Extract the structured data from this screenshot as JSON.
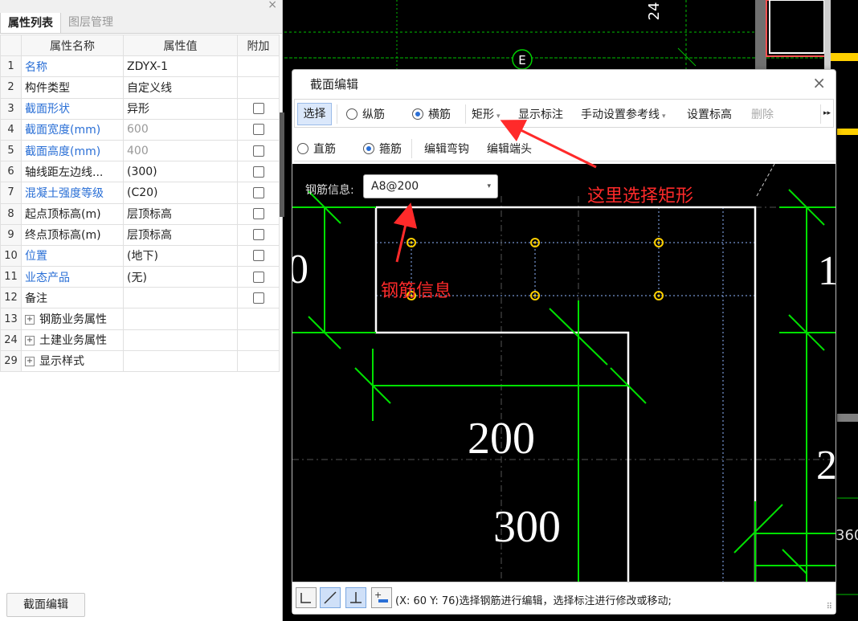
{
  "left_panel": {
    "tabs": [
      {
        "label": "属性列表",
        "active": true
      },
      {
        "label": "图层管理",
        "active": false
      }
    ],
    "columns": {
      "num": "",
      "name": "属性名称",
      "value": "属性值",
      "attach": "附加"
    },
    "rows": [
      {
        "num": "1",
        "name": "名称",
        "value": "ZDYX-1",
        "name_blue": true,
        "value_gray": false,
        "checkbox": false
      },
      {
        "num": "2",
        "name": "构件类型",
        "value": "自定义线",
        "name_blue": false,
        "value_gray": false,
        "checkbox": false
      },
      {
        "num": "3",
        "name": "截面形状",
        "value": "异形",
        "name_blue": true,
        "value_gray": false,
        "checkbox": true
      },
      {
        "num": "4",
        "name": "截面宽度(mm)",
        "value": "600",
        "name_blue": true,
        "value_gray": true,
        "checkbox": true
      },
      {
        "num": "5",
        "name": "截面高度(mm)",
        "value": "400",
        "name_blue": true,
        "value_gray": true,
        "checkbox": true
      },
      {
        "num": "6",
        "name": "轴线距左边线...",
        "value": "(300)",
        "name_blue": false,
        "value_gray": false,
        "checkbox": true
      },
      {
        "num": "7",
        "name": "混凝土强度等级",
        "value": "(C20)",
        "name_blue": true,
        "value_gray": false,
        "checkbox": true
      },
      {
        "num": "8",
        "name": "起点顶标高(m)",
        "value": "层顶标高",
        "name_blue": false,
        "value_gray": false,
        "checkbox": true
      },
      {
        "num": "9",
        "name": "终点顶标高(m)",
        "value": "层顶标高",
        "name_blue": false,
        "value_gray": false,
        "checkbox": true
      },
      {
        "num": "10",
        "name": "位置",
        "value": "(地下)",
        "name_blue": true,
        "value_gray": false,
        "checkbox": true
      },
      {
        "num": "11",
        "name": "业态产品",
        "value": "(无)",
        "name_blue": true,
        "value_gray": false,
        "checkbox": true
      },
      {
        "num": "12",
        "name": "备注",
        "value": "",
        "name_blue": false,
        "value_gray": false,
        "checkbox": true
      },
      {
        "num": "13",
        "name": "钢筋业务属性",
        "value": "",
        "group": true,
        "expander": "+"
      },
      {
        "num": "24",
        "name": "土建业务属性",
        "value": "",
        "group": true,
        "expander": "+"
      },
      {
        "num": "29",
        "name": "显示样式",
        "value": "",
        "group": true,
        "expander": "+"
      }
    ],
    "bottom_button": "截面编辑",
    "close_glyph": "×"
  },
  "cad": {
    "axis_label": "E",
    "dim_top": "24",
    "dim_right_bottom": "360"
  },
  "dialog": {
    "title": "截面编辑",
    "close_glyph": "×",
    "toolbar1": {
      "select": "选择",
      "longitudinal": "纵筋",
      "transverse": "横筋",
      "rectangle": "矩形",
      "show_annotation": "显示标注",
      "manual_ref_line": "手动设置参考线",
      "set_elevation": "设置标高",
      "delete": "删除",
      "more_glyph": "▸▸"
    },
    "toolbar2": {
      "straight": "直筋",
      "stirrup": "箍筋",
      "edit_hook": "编辑弯钩",
      "edit_end": "编辑端头"
    },
    "rebar_info": {
      "label": "钢筋信息:",
      "value": "A8@200"
    },
    "dims": {
      "d200": "200",
      "d300": "300",
      "left_cut": "0",
      "right_cut1": "1",
      "right_cut2": "2"
    },
    "status_text": "(X: 60 Y: 76)选择钢筋进行编辑，选择标注进行修改或移动;",
    "resize_glyph": "⠿"
  },
  "annotations": {
    "choose_rect": "这里选择矩形",
    "rebar_info": "钢筋信息"
  },
  "colors": {
    "annotation_red": "#ff2a2a",
    "cad_green": "#00e000",
    "rebar_yellow": "#ffd000",
    "link_blue": "#2a6fd6"
  }
}
